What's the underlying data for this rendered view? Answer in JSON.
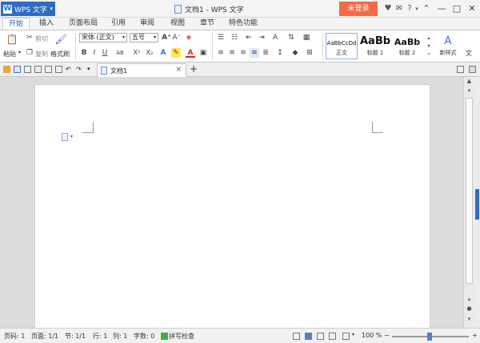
{
  "titlebar": {
    "app_label": "WPS 文字",
    "window_title": "文档1 - WPS 文字",
    "login_label": "未登录",
    "help_label": "?",
    "icons": [
      "skin-icon",
      "share-icon",
      "help-icon",
      "ribbon-collapse-icon",
      "minimize-icon",
      "maximize-icon",
      "close-icon"
    ]
  },
  "tabs": [
    {
      "label": "开始",
      "active": true
    },
    {
      "label": "插入"
    },
    {
      "label": "页面布局"
    },
    {
      "label": "引用"
    },
    {
      "label": "审阅"
    },
    {
      "label": "视图"
    },
    {
      "label": "章节"
    },
    {
      "label": "特色功能"
    }
  ],
  "clipboard": {
    "paste": "粘贴",
    "cut": "剪切",
    "copy": "复制",
    "format_painter": "格式刷"
  },
  "font": {
    "family": "宋体 (正文)",
    "size": "五号",
    "bold": "B",
    "italic": "I",
    "underline": "U",
    "strike": "AB",
    "superscript": "X²",
    "subscript": "X₂",
    "grow": "A⁺",
    "shrink": "A⁻",
    "text_effect": "A"
  },
  "styles": [
    {
      "sample": "AaBbCcDd",
      "label": "正文",
      "active": true
    },
    {
      "sample": "AaBb",
      "label": "标题 1"
    },
    {
      "sample": "AaBb",
      "label": "标题 2"
    },
    {
      "sample": "A",
      "label": "新样式"
    }
  ],
  "style_extra": "文",
  "document_tab": {
    "name": "文档1",
    "close": "×",
    "new_tab": "+"
  },
  "status": {
    "page_number": "页码: 1",
    "pages": "页面: 1/1",
    "section": "节: 1/1",
    "row": "行: 1",
    "column": "列: 1",
    "word_count": "字数: 0",
    "spell_check": "拼写检查",
    "zoom": "100 %",
    "zoom_out": "−",
    "zoom_in": "+"
  },
  "colors": {
    "brand_blue": "#2d6cc3",
    "login_orange": "#f26b45",
    "spell_check_green": "#3cb043"
  }
}
